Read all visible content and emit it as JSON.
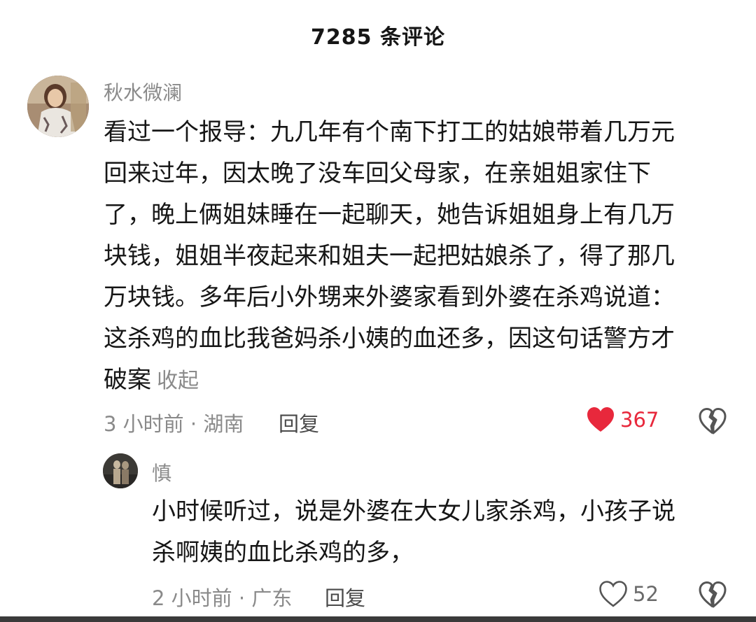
{
  "header": {
    "title": "7285 条评论"
  },
  "comments": [
    {
      "username": "秋水微澜",
      "lines": [
        "看过一个报导：九几年有个南下打工的姑娘带着几万元",
        "回来过年，因太晚了没车回父母家，在亲姐姐家住下",
        "了，晚上俩姐妹睡在一起聊天，她告诉姐姐身上有几万",
        "块钱，姐姐半夜起来和姐夫一起把姑娘杀了，得了那几",
        "万块钱。多年后小外甥来外婆家看到外婆在杀鸡说道：",
        "这杀鸡的血比我爸妈杀小姨的血还多，因这句话警方才",
        "破案"
      ],
      "collapse_label": "收起",
      "time": "3 小时前",
      "location": "湖南",
      "meta_separator": " · ",
      "reply_label": "回复",
      "likes": "367",
      "liked": true
    },
    {
      "username": "慎",
      "lines": [
        "小时候听过，说是外婆在大女儿家杀鸡，小孩子说",
        "杀啊姨的血比杀鸡的多，"
      ],
      "time": "2 小时前",
      "location": "广东",
      "meta_separator": " · ",
      "reply_label": "回复",
      "likes": "52",
      "liked": false
    }
  ],
  "colors": {
    "like_active": "#e8283c",
    "secondary_text": "#8a8a8a",
    "primary_text": "#161616"
  },
  "icons": {
    "like": "heart-icon",
    "dislike": "broken-heart-icon"
  }
}
